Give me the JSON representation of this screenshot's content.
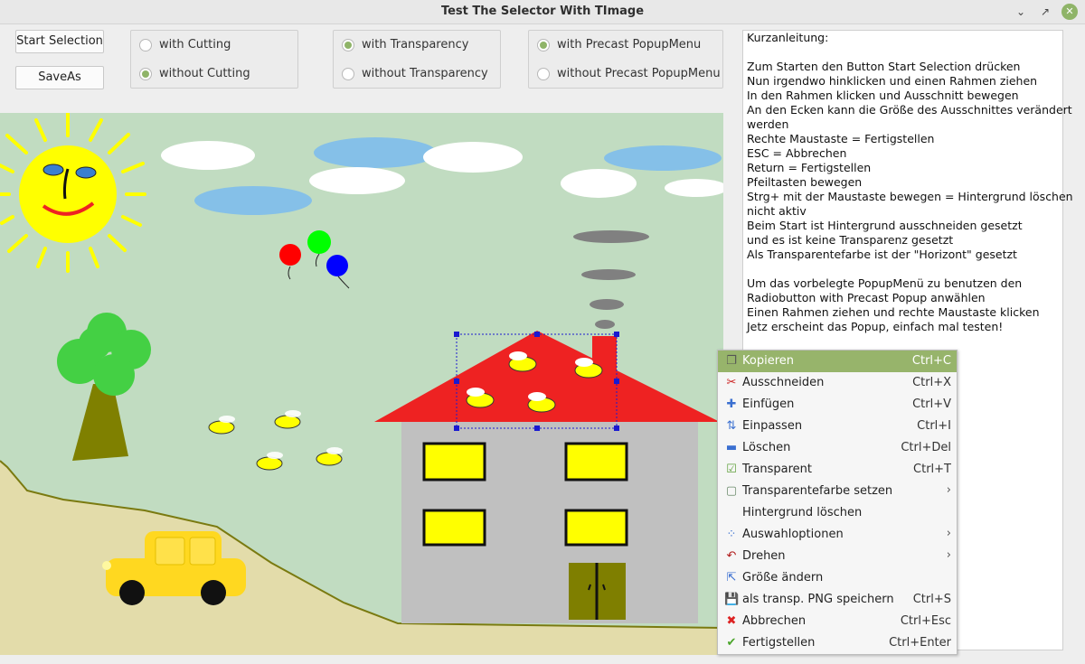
{
  "window": {
    "title": "Test The Selector With TImage"
  },
  "buttons": {
    "start": "Start Selection",
    "save": "SaveAs"
  },
  "groups": [
    {
      "options": [
        {
          "label": "with Cutting",
          "checked": false
        },
        {
          "label": "without Cutting",
          "checked": true
        }
      ]
    },
    {
      "options": [
        {
          "label": "with Transparency",
          "checked": true
        },
        {
          "label": "without Transparency",
          "checked": false
        }
      ]
    },
    {
      "options": [
        {
          "label": "with Precast PopupMenu",
          "checked": true
        },
        {
          "label": "without Precast PopupMenu",
          "checked": false
        }
      ]
    }
  ],
  "memo_lines": [
    "Kurzanleitung:",
    "",
    "Zum Starten den Button Start Selection drücken",
    "Nun irgendwo hinklicken und einen Rahmen ziehen",
    "In den Rahmen klicken und Ausschnitt bewegen",
    "An den Ecken kann die Größe des Ausschnittes verändert",
    "werden",
    "Rechte Maustaste = Fertigstellen",
    "ESC = Abbrechen",
    "Return = Fertigstellen",
    "Pfeiltasten bewegen",
    "Strg+ mit der Maustaste bewegen = Hintergrund löschen",
    "nicht aktiv",
    "Beim Start ist Hintergrund ausschneiden gesetzt",
    "und es ist keine Transparenz gesetzt",
    "Als Transparentefarbe ist der \"Horizont\" gesetzt",
    "",
    "Um das vorbelegte PopupMenü zu benutzen den",
    "Radiobutton with Precast Popup anwählen",
    "Einen Rahmen ziehen und rechte Maustaste klicken",
    "Jetz erscheint das Popup, einfach mal testen!"
  ],
  "menu": [
    {
      "label": "Kopieren",
      "shortcut": "Ctrl+C",
      "icon": "copy-icon",
      "selected": true
    },
    {
      "label": "Ausschneiden",
      "shortcut": "Ctrl+X",
      "icon": "scissors-icon"
    },
    {
      "label": "Einfügen",
      "shortcut": "Ctrl+V",
      "icon": "plus-icon"
    },
    {
      "label": "Einpassen",
      "shortcut": "Ctrl+I",
      "icon": "fit-icon"
    },
    {
      "label": "Löschen",
      "shortcut": "Ctrl+Del",
      "icon": "minus-icon"
    },
    {
      "label": "Transparent",
      "shortcut": "Ctrl+T",
      "icon": "checkbox-icon"
    },
    {
      "label": "Transparentefarbe setzen",
      "submenu": true,
      "icon": "color-swatch-icon"
    },
    {
      "label": "Hintergrund löschen",
      "icon": ""
    },
    {
      "label": "Auswahloptionen",
      "submenu": true,
      "icon": "options-icon"
    },
    {
      "label": "Drehen",
      "submenu": true,
      "icon": "rotate-icon"
    },
    {
      "label": "Größe ändern",
      "icon": "resize-icon"
    },
    {
      "label": "als transp. PNG speichern",
      "shortcut": "Ctrl+S",
      "icon": "save-png-icon"
    },
    {
      "label": "Abbrechen",
      "shortcut": "Ctrl+Esc",
      "icon": "cancel-icon"
    },
    {
      "label": "Fertigstellen",
      "shortcut": "Ctrl+Enter",
      "icon": "check-icon"
    }
  ],
  "colors": {
    "accent": "#97b46b",
    "sky": "#c1dcc1",
    "roof": "#ee2222",
    "wall": "#c0c0c0",
    "window": "#ffff00",
    "sun": "#ffff00",
    "car": "#ffd820",
    "ground": "#e3dcaa"
  }
}
